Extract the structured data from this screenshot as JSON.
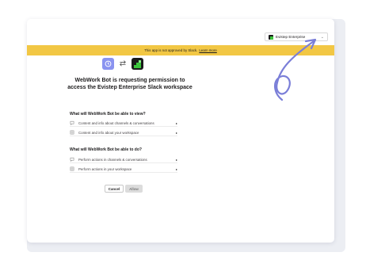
{
  "workspace_select": {
    "name": "Evistep Enterprise",
    "chevron": "⌄"
  },
  "banner": {
    "text": "This app is not approved by Slack.",
    "link": "Learn more"
  },
  "apps": {
    "left_icon": "webwork-clock-icon",
    "swap_icon": "⇄",
    "right_icon": "evistep-logo-icon"
  },
  "heading": {
    "line1": "WebWork Bot is requesting permission to",
    "line2": "access the Evistep Enterprise Slack workspace"
  },
  "view_section": {
    "title": "What will WebWork Bot be able to view?",
    "items": [
      {
        "label": "Content and info about channels & conversations",
        "icon": "chat-bubble-icon"
      },
      {
        "label": "Content and info about your workspace",
        "icon": "grid-icon"
      }
    ]
  },
  "do_section": {
    "title": "What will WebWork Bot be able to do?",
    "items": [
      {
        "label": "Perform actions in channels & conversations",
        "icon": "chat-bubble-icon"
      },
      {
        "label": "Perform actions in your workspace",
        "icon": "grid-icon"
      }
    ]
  },
  "buttons": {
    "cancel": "Cancel",
    "allow": "Allow"
  },
  "colors": {
    "banner": "#f2c744",
    "accent_purple": "#8a93f0",
    "scribble": "#7b7fd8"
  }
}
